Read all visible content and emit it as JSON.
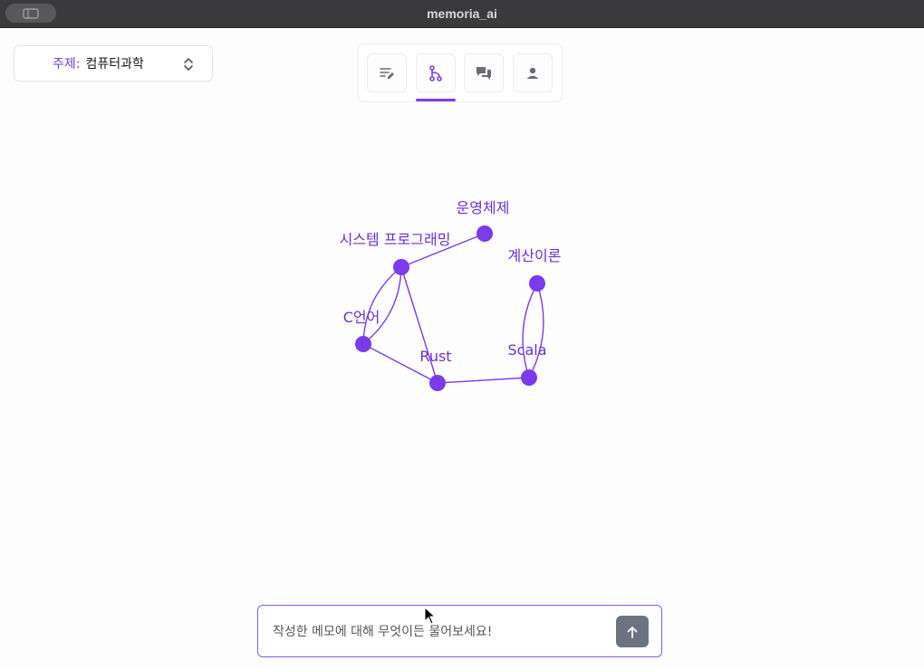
{
  "window": {
    "title": "memoria_ai"
  },
  "topic_selector": {
    "label": "주제:",
    "value": "컴퓨터과학"
  },
  "tabs": [
    {
      "id": "notes",
      "icon": "edit-list-icon",
      "active": false
    },
    {
      "id": "graph",
      "icon": "graph-branch-icon",
      "active": true
    },
    {
      "id": "chat",
      "icon": "chat-bubbles-icon",
      "active": false
    },
    {
      "id": "profile",
      "icon": "person-icon",
      "active": false
    }
  ],
  "graph": {
    "colors": {
      "node": "#7c3aed",
      "edge": "#7c3aed",
      "label": "#6d2fd6"
    },
    "nodes": [
      {
        "id": "os",
        "label": "운영체제"
      },
      {
        "id": "sysprog",
        "label": "시스템 프로그래밍"
      },
      {
        "id": "theory",
        "label": "계산이론"
      },
      {
        "id": "c",
        "label": "C언어"
      },
      {
        "id": "rust",
        "label": "Rust"
      },
      {
        "id": "scala",
        "label": "Scala"
      }
    ],
    "edges": [
      {
        "from": "os",
        "to": "sysprog"
      },
      {
        "from": "sysprog",
        "to": "c"
      },
      {
        "from": "c",
        "to": "sysprog"
      },
      {
        "from": "sysprog",
        "to": "rust"
      },
      {
        "from": "c",
        "to": "rust"
      },
      {
        "from": "rust",
        "to": "scala"
      },
      {
        "from": "theory",
        "to": "scala"
      },
      {
        "from": "scala",
        "to": "theory"
      }
    ]
  },
  "chat": {
    "placeholder": "작성한 메모에 대해 무엇이든 물어보세요!"
  },
  "accent_color": "#7b3fe4"
}
